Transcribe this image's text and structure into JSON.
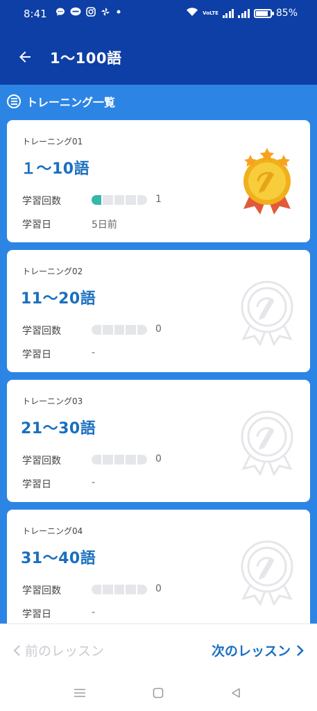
{
  "status_bar": {
    "time": "8:41",
    "battery": "85%",
    "battery_level": 0.85,
    "icons_left": [
      "message-bubble-icon",
      "line-icon",
      "instagram-icon",
      "pinwheel-icon",
      "dot-icon"
    ],
    "icons_right": [
      "wifi-icon",
      "volte-icon",
      "signal-icon",
      "signal-icon",
      "battery-icon"
    ],
    "volte_text": "VoLTE"
  },
  "app_bar": {
    "title": "1〜100語",
    "back_icon": "arrow-left-icon"
  },
  "section": {
    "title": "トレーニング一覧",
    "icon": "list-circle-icon"
  },
  "cards": [
    {
      "label": "トレーニング01",
      "title": "１〜10語",
      "count_label": "学習回数",
      "count": "1",
      "progress_segments_done": 1,
      "progress_segments_total": 5,
      "date_label": "学習日",
      "date": "5日前",
      "medal": "gold-medal-icon"
    },
    {
      "label": "トレーニング02",
      "title": "11〜20語",
      "count_label": "学習回数",
      "count": "0",
      "progress_segments_done": 0,
      "progress_segments_total": 5,
      "date_label": "学習日",
      "date": "-",
      "medal": "gray-medal-icon"
    },
    {
      "label": "トレーニング03",
      "title": "21〜30語",
      "count_label": "学習回数",
      "count": "0",
      "progress_segments_done": 0,
      "progress_segments_total": 5,
      "date_label": "学習日",
      "date": "-",
      "medal": "gray-medal-icon"
    },
    {
      "label": "トレーニング04",
      "title": "31〜40語",
      "count_label": "学習回数",
      "count": "0",
      "progress_segments_done": 0,
      "progress_segments_total": 5,
      "date_label": "学習日",
      "date": "-",
      "medal": "gray-medal-icon"
    }
  ],
  "footer": {
    "prev": "前のレッスン",
    "next": "次のレッスン",
    "prev_icon": "chevron-left-icon",
    "next_icon": "chevron-right-icon"
  },
  "nav_bar": {
    "icons": [
      "menu-icon",
      "home-square-icon",
      "back-triangle-icon"
    ]
  },
  "colors": {
    "header": "#0e3fa6",
    "content_bg": "#2c85e4",
    "title_blue": "#1a6fbf",
    "progress_done": "#35b8aa",
    "progress_empty": "#e4e6e9",
    "gold": "#f5c02d"
  }
}
